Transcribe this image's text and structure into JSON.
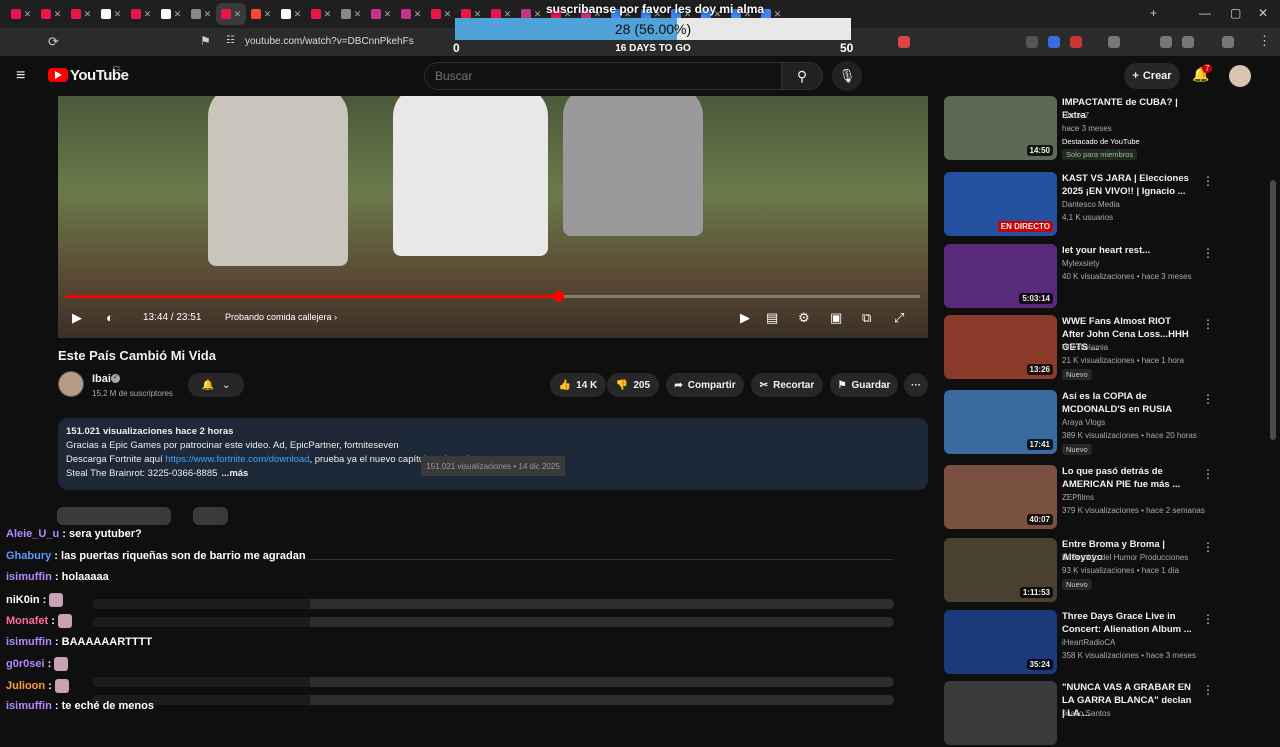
{
  "browser": {
    "url": "youtube.com/watch?v=DBCnnPkehFs",
    "tab_colors": [
      "#e9154a",
      "#e9154a",
      "#e9154a",
      "#ffffff",
      "#e9154a",
      "#ffffff",
      "#888888",
      "#e9154a",
      "#ff4444",
      "#ffffff",
      "#e9154a",
      "#888888",
      "#c13584",
      "#c13584",
      "#e9154a",
      "#e9154a",
      "#e9154a",
      "#c13584",
      "#e9154a",
      "#c13584",
      "#4285f4",
      "#4285f4",
      "#4285f4",
      "#4285f4",
      "#4285f4",
      "#4285f4"
    ]
  },
  "overlay": {
    "title": "suscribanse por favor les doy mi alma",
    "goal_text": "28 (56.00%)",
    "goal_fraction": 0.56,
    "min": "0",
    "max": "50",
    "days": "16 DAYS TO GO"
  },
  "header": {
    "logo": "YouTube",
    "country": "CL",
    "search_placeholder": "Buscar",
    "create_label": "Crear",
    "notifications": "7"
  },
  "player": {
    "time": "13:44 / 23:51",
    "chapter": "Probando comida callejera",
    "progress_fraction": 0.576
  },
  "video": {
    "title": "Este País Cambió Mi Vida",
    "channel": "Ibai",
    "subscribers": "15,2 M de suscriptores",
    "likes": "14 K",
    "dislikes": "205",
    "share": "Compartir",
    "clip": "Recortar",
    "save": "Guardar"
  },
  "description": {
    "stats": "151.021 visualizaciones  hace 2 horas",
    "line1": "Gracias a Epic Games por patrocinar este video. Ad, EpicPartner, fortniteseven",
    "line2_prefix": "Descarga Fortnite aquí ",
    "link": "https://www.fortnite.com/download",
    "line2_suffix": ", prueba ya el nuevo capítulo y descubre mapas como estos:",
    "line3": "Steal The Brainrot: 3225-0366-8885",
    "more": "...más",
    "tooltip": "151.021 visualizaciones • 14 dic 2025"
  },
  "chat": [
    {
      "user": "Aleie_U_u",
      "color": "#b388ff",
      "msg": "sera yutuber?"
    },
    {
      "user": "Ghabury",
      "color": "#5b9bff",
      "msg": "las puertas riqueñas son de barrio me agradan"
    },
    {
      "user": "isimuffin",
      "color": "#b388ff",
      "msg": "holaaaaa"
    },
    {
      "user": "niK0in",
      "color": "#ffffff",
      "msg": ""
    },
    {
      "user": "Monafet",
      "color": "#ff6b9e",
      "msg": ""
    },
    {
      "user": "isimuffin",
      "color": "#b388ff",
      "msg": "BAAAAAARTTTT"
    },
    {
      "user": "g0r0sei",
      "color": "#b388ff",
      "msg": ""
    },
    {
      "user": "Julioon",
      "color": "#ff9f3a",
      "msg": ""
    },
    {
      "user": "isimuffin",
      "color": "#b388ff",
      "msg": "te eché de menos"
    }
  ],
  "sidebar": [
    {
      "title": "IMPACTANTE de CUBA? | Extra",
      "channel": "Claux.7",
      "meta": "hace 3 meses",
      "badge": "Destacado de YouTube",
      "badge2": "Solo para miembros",
      "duration": "14:50",
      "thumb": "#5a6a55"
    },
    {
      "title": "KAST VS JARA | Elecciones 2025 ¡EN VIVO!! | Ignacio ...",
      "channel": "Dantesco Media",
      "meta": "4,1 K usuarios",
      "badge": "",
      "badge2": "",
      "duration": "EN DIRECTO",
      "thumb": "#2450a0"
    },
    {
      "title": "let your heart rest...",
      "channel": "Mylexsiety",
      "meta": "40 K visualizaciones • hace 3 meses",
      "badge": "",
      "badge2": "",
      "duration": "5:03:14",
      "thumb": "#5a2a7a"
    },
    {
      "title": "WWE Fans Almost RIOT After John Cena Loss...HHH GETS ...",
      "channel": "Wrestlelamia",
      "meta": "21 K visualizaciones • hace 1 hora",
      "badge": "Nuevo",
      "badge2": "",
      "duration": "13:26",
      "thumb": "#8a3a2a"
    },
    {
      "title": "Así es la COPIA de MCDONALD'S en RUSIA",
      "channel": "Araya Vlogs",
      "meta": "389 K visualizaciones • hace 20 horas",
      "badge": "Nuevo",
      "badge2": "",
      "duration": "17:41",
      "thumb": "#3a6aa0"
    },
    {
      "title": "Lo que pasó detrás de AMERICAN PIE fue más ...",
      "channel": "ZEPfilms",
      "meta": "379 K visualizaciones • hace 2 semanas",
      "badge": "",
      "badge2": "",
      "duration": "40:07",
      "thumb": "#7a5040"
    },
    {
      "title": "Entre Broma y Broma | Altoyoyo",
      "channel": "El Sentido del Humor Producciones",
      "meta": "93 K visualizaciones • hace 1 día",
      "badge": "Nuevo",
      "badge2": "",
      "duration": "1:11:53",
      "thumb": "#4a4030"
    },
    {
      "title": "Three Days Grace Live in Concert: Alienation Album ...",
      "channel": "iHeartRadioCA",
      "meta": "358 K visualizaciones • hace 3 meses",
      "badge": "",
      "badge2": "",
      "duration": "35:24",
      "thumb": "#1a3a7a"
    },
    {
      "title": "\"NUNCA VAS A GRABAR EN LA GARRA BLANCA\" declan | LA ...",
      "channel": "Joaco Santos",
      "meta": "",
      "badge": "",
      "badge2": "",
      "duration": "",
      "thumb": "#3a3a3a"
    }
  ]
}
